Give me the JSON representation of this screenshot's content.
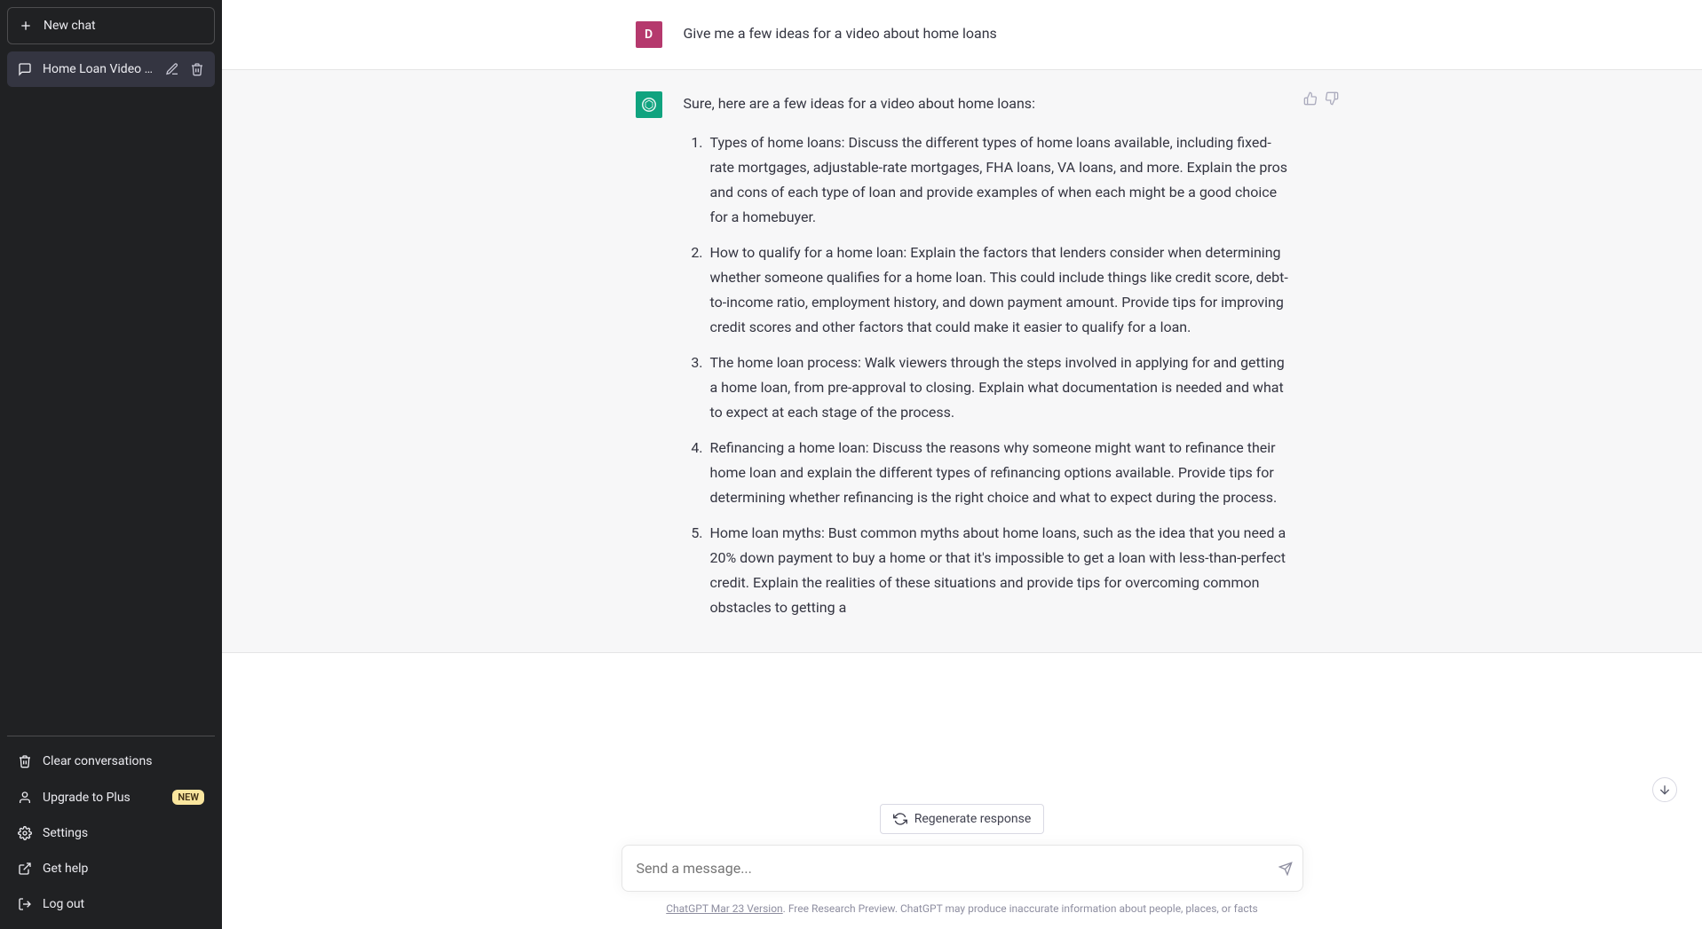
{
  "sidebar": {
    "new_chat_label": "New chat",
    "active_chat_title": "Home Loan Video Idea",
    "bottom": {
      "clear": "Clear conversations",
      "upgrade": "Upgrade to Plus",
      "upgrade_badge": "NEW",
      "settings": "Settings",
      "help": "Get help",
      "logout": "Log out"
    }
  },
  "conversation": {
    "user_message": "Give me a few ideas for a video about home loans",
    "user_initial": "D",
    "assistant_intro": "Sure, here are a few ideas for a video about home loans:",
    "assistant_items": [
      "Types of home loans: Discuss the different types of home loans available, including fixed-rate mortgages, adjustable-rate mortgages, FHA loans, VA loans, and more. Explain the pros and cons of each type of loan and provide examples of when each might be a good choice for a homebuyer.",
      "How to qualify for a home loan: Explain the factors that lenders consider when determining whether someone qualifies for a home loan. This could include things like credit score, debt-to-income ratio, employment history, and down payment amount. Provide tips for improving credit scores and other factors that could make it easier to qualify for a loan.",
      "The home loan process: Walk viewers through the steps involved in applying for and getting a home loan, from pre-approval to closing. Explain what documentation is needed and what to expect at each stage of the process.",
      "Refinancing a home loan: Discuss the reasons why someone might want to refinance their home loan and explain the different types of refinancing options available. Provide tips for determining whether refinancing is the right choice and what to expect during the process.",
      "Home loan myths: Bust common myths about home loans, such as the idea that you need a 20% down payment to buy a home or that it's impossible to get a loan with less-than-perfect credit. Explain the realities of these situations and provide tips for overcoming common obstacles to getting a"
    ]
  },
  "footer": {
    "regenerate": "Regenerate response",
    "input_placeholder": "Send a message...",
    "version_label": "ChatGPT Mar 23 Version",
    "disclaimer": ". Free Research Preview. ChatGPT may produce inaccurate information about people, places, or facts"
  }
}
